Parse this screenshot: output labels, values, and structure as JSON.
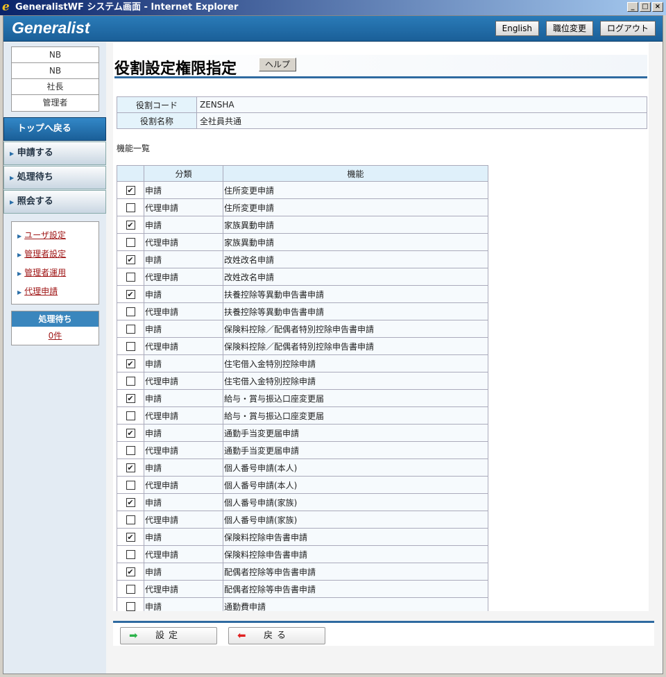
{
  "window": {
    "title": "GeneralistWF システム画面 - Internet Explorer",
    "buttons": [
      "_",
      "□",
      "×"
    ]
  },
  "header": {
    "logo": "Generalist",
    "buttons": [
      "English",
      "職位変更",
      "ログアウト"
    ]
  },
  "sidebar": {
    "user_info": [
      "NB",
      "NB",
      "社長",
      "管理者"
    ],
    "nav": [
      "トップへ戻る",
      "申請する",
      "処理待ち",
      "照会する"
    ],
    "links": [
      "ユーザ設定",
      "管理者設定",
      "管理者運用",
      "代理申請"
    ],
    "pending": {
      "title": "処理待ち",
      "value": "0件"
    }
  },
  "main": {
    "title": "役割設定権限指定",
    "help": "ヘルプ",
    "info": [
      {
        "label": "役割コード",
        "value": "ZENSHA"
      },
      {
        "label": "役割名称",
        "value": "全社員共通"
      }
    ],
    "list_label": "機能一覧",
    "columns": [
      "",
      "分類",
      "機能"
    ],
    "rows": [
      {
        "checked": true,
        "cat": "申請",
        "func": "住所変更申請"
      },
      {
        "checked": false,
        "cat": "代理申請",
        "func": "住所変更申請"
      },
      {
        "checked": true,
        "cat": "申請",
        "func": "家族異動申請"
      },
      {
        "checked": false,
        "cat": "代理申請",
        "func": "家族異動申請"
      },
      {
        "checked": true,
        "cat": "申請",
        "func": "改姓改名申請"
      },
      {
        "checked": false,
        "cat": "代理申請",
        "func": "改姓改名申請"
      },
      {
        "checked": true,
        "cat": "申請",
        "func": "扶養控除等異動申告書申請"
      },
      {
        "checked": false,
        "cat": "代理申請",
        "func": "扶養控除等異動申告書申請"
      },
      {
        "checked": false,
        "cat": "申請",
        "func": "保険料控除／配偶者特別控除申告書申請"
      },
      {
        "checked": false,
        "cat": "代理申請",
        "func": "保険料控除／配偶者特別控除申告書申請"
      },
      {
        "checked": true,
        "cat": "申請",
        "func": "住宅借入金特別控除申請"
      },
      {
        "checked": false,
        "cat": "代理申請",
        "func": "住宅借入金特別控除申請"
      },
      {
        "checked": true,
        "cat": "申請",
        "func": "給与・賞与振込口座変更届"
      },
      {
        "checked": false,
        "cat": "代理申請",
        "func": "給与・賞与振込口座変更届"
      },
      {
        "checked": true,
        "cat": "申請",
        "func": "通勤手当変更届申請"
      },
      {
        "checked": false,
        "cat": "代理申請",
        "func": "通勤手当変更届申請"
      },
      {
        "checked": true,
        "cat": "申請",
        "func": "個人番号申請(本人)"
      },
      {
        "checked": false,
        "cat": "代理申請",
        "func": "個人番号申請(本人)"
      },
      {
        "checked": true,
        "cat": "申請",
        "func": "個人番号申請(家族)"
      },
      {
        "checked": false,
        "cat": "代理申請",
        "func": "個人番号申請(家族)"
      },
      {
        "checked": true,
        "cat": "申請",
        "func": "保険料控除申告書申請"
      },
      {
        "checked": false,
        "cat": "代理申請",
        "func": "保険料控除申告書申請"
      },
      {
        "checked": true,
        "cat": "申請",
        "func": "配偶者控除等申告書申請"
      },
      {
        "checked": false,
        "cat": "代理申請",
        "func": "配偶者控除等申告書申請"
      },
      {
        "checked": false,
        "cat": "申請",
        "func": "通勤費申請"
      }
    ]
  },
  "footer": {
    "set": "設定",
    "back": "戻る"
  }
}
